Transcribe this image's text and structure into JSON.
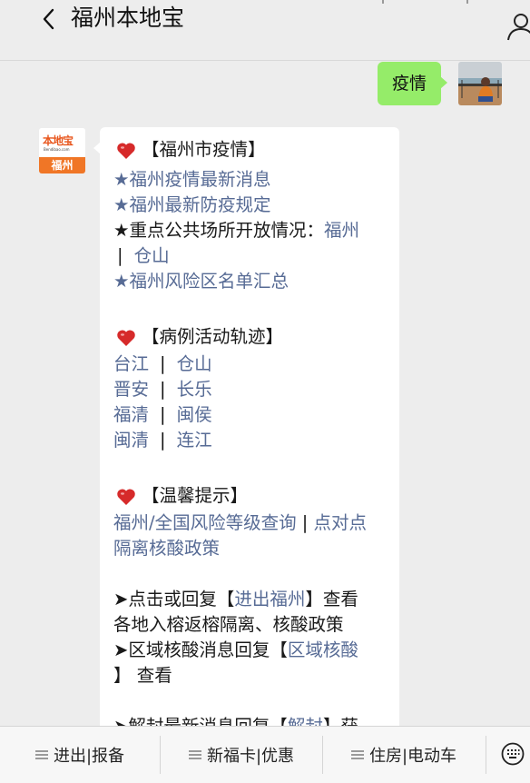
{
  "header": {
    "title": "福州本地宝",
    "back_icon": "chevron-left-icon",
    "profile_icon": "person-icon"
  },
  "outgoing": {
    "text": "疫情"
  },
  "bot": {
    "logo_main": "本地宝",
    "logo_url": "Bendibao.com",
    "logo_city": "福州"
  },
  "message": {
    "s1_title": "【福州市疫情】",
    "s1_l1": "★福州疫情最新消息",
    "s1_l2": "★福州最新防疫规定",
    "s1_l3_text": "★重点公共场所开放情况：",
    "s1_l3_link": "福州",
    "s1_l4_sep": "|",
    "s1_l4_link": "仓山",
    "s1_l5": "★福州风险区名单汇总",
    "s2_title": "【病例活动轨迹】",
    "districts": [
      [
        "台江",
        "仓山"
      ],
      [
        "晋安",
        "长乐"
      ],
      [
        "福清",
        "闽侯"
      ],
      [
        "闽清",
        "连江"
      ]
    ],
    "pipe": "|",
    "s3_title": "【温馨提示】",
    "s3_link1": "福州/全国风险等级查询",
    "s3_sep": " | ",
    "s3_link2a": "点对点",
    "s3_link2b": "隔离核酸政策",
    "s4_l1_pre": "➤点击或回复【",
    "s4_l1_link": "进出福州",
    "s4_l1_post": "】查看",
    "s4_l2": "各地入榕返榕隔离、核酸政策",
    "s4_l3_pre": "➤区域核酸消息回复【",
    "s4_l3_link": "区域核酸",
    "s4_l4_post": "】 查看",
    "s5_partial_pre": "➤解封最新消息回复【",
    "s5_partial_link": "解封",
    "s5_partial_post": "】获"
  },
  "bottom_menu": {
    "item1": "进出|报备",
    "item2": "新福卡|优惠",
    "item3": "住房|电动车",
    "keyboard_icon": "keyboard-icon"
  },
  "colors": {
    "link": "#576b95",
    "outgoing_bubble": "#95ec69",
    "heart": "#d62a2a",
    "logo_orange": "#f07626"
  }
}
